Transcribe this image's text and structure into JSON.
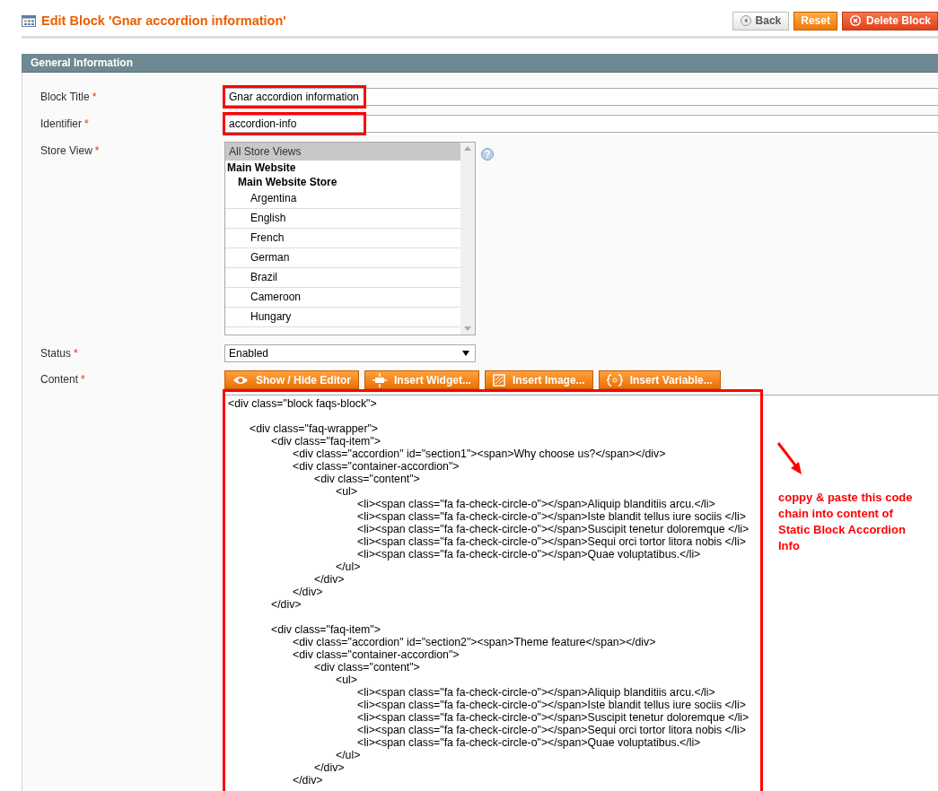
{
  "header": {
    "title": "Edit Block 'Gnar accordion information'",
    "buttons": [
      {
        "kind": "back",
        "label": "Back"
      },
      {
        "kind": "reset",
        "label": "Reset"
      },
      {
        "kind": "delete",
        "label": "Delete Block"
      }
    ]
  },
  "section": {
    "title": "General Information"
  },
  "fields": [
    {
      "kind": "text",
      "label": "Block Title",
      "marker": "*",
      "value": "Gnar accordion information",
      "highlighted": true
    },
    {
      "kind": "text",
      "label": "Identifier",
      "marker": "*",
      "value": "accordion-info",
      "highlighted": true
    },
    {
      "kind": "multiselect",
      "label": "Store View",
      "marker": "*",
      "options": [
        {
          "label": "All Store Views",
          "selected": true
        },
        {
          "label": "Main Website",
          "children": [
            {
              "label": "Main Website Store",
              "children": [
                {
                  "label": "Argentina",
                  "selected": false
                },
                {
                  "label": "English",
                  "selected": false
                },
                {
                  "label": "French",
                  "selected": false
                },
                {
                  "label": "German",
                  "selected": false
                },
                {
                  "label": "Brazil",
                  "selected": false
                },
                {
                  "label": "Cameroon",
                  "selected": false
                },
                {
                  "label": "Hungary",
                  "selected": false
                }
              ]
            }
          ]
        }
      ]
    },
    {
      "kind": "select",
      "label": "Status",
      "marker": "*",
      "value": "Enabled"
    },
    {
      "kind": "editor",
      "label": "Content",
      "marker": "*",
      "buttons": [
        {
          "kind": "eye",
          "label": "Show / Hide Editor"
        },
        {
          "kind": "widget",
          "label": "Insert Widget..."
        },
        {
          "kind": "image",
          "label": "Insert Image..."
        },
        {
          "kind": "variable",
          "label": "Insert Variable..."
        }
      ],
      "value": "<div class=\"block faqs-block\">\n\n\t<div class=\"faq-wrapper\">\n\t\t<div class=\"faq-item\">\n\t\t\t<div class=\"accordion\" id=\"section1\"><span>Why choose us?</span></div>\n\t\t\t<div class=\"container-accordion\">\n\t\t\t\t<div class=\"content\">\n\t\t\t\t\t<ul>\n\t\t\t\t\t\t<li><span class=\"fa fa-check-circle-o\"></span>Aliquip blanditiis arcu.</li>\n\t\t\t\t\t\t<li><span class=\"fa fa-check-circle-o\"></span>Iste blandit tellus iure sociis </li>\n\t\t\t\t\t\t<li><span class=\"fa fa-check-circle-o\"></span>Suscipit tenetur doloremque </li>\n\t\t\t\t\t\t<li><span class=\"fa fa-check-circle-o\"></span>Sequi orci tortor litora nobis </li>\n\t\t\t\t\t\t<li><span class=\"fa fa-check-circle-o\"></span>Quae voluptatibus.</li>\n\t\t\t\t\t</ul>\n\t\t\t\t</div>\n\t\t\t</div>\n\t\t</div>\n\n\t\t<div class=\"faq-item\">\n\t\t\t<div class=\"accordion\" id=\"section2\"><span>Theme feature</span></div>\n\t\t\t<div class=\"container-accordion\">\n\t\t\t\t<div class=\"content\">\n\t\t\t\t\t<ul>\n\t\t\t\t\t\t<li><span class=\"fa fa-check-circle-o\"></span>Aliquip blanditiis arcu.</li>\n\t\t\t\t\t\t<li><span class=\"fa fa-check-circle-o\"></span>Iste blandit tellus iure sociis </li>\n\t\t\t\t\t\t<li><span class=\"fa fa-check-circle-o\"></span>Suscipit tenetur doloremque </li>\n\t\t\t\t\t\t<li><span class=\"fa fa-check-circle-o\"></span>Sequi orci tortor litora nobis </li>\n\t\t\t\t\t\t<li><span class=\"fa fa-check-circle-o\"></span>Quae voluptatibus.</li>\n\t\t\t\t\t</ul>\n\t\t\t\t</div>\n\t\t\t</div>",
      "highlighted": true
    }
  ],
  "annotation": {
    "note": "coppy & paste this code chain into content of Static Block Accordion Info"
  }
}
